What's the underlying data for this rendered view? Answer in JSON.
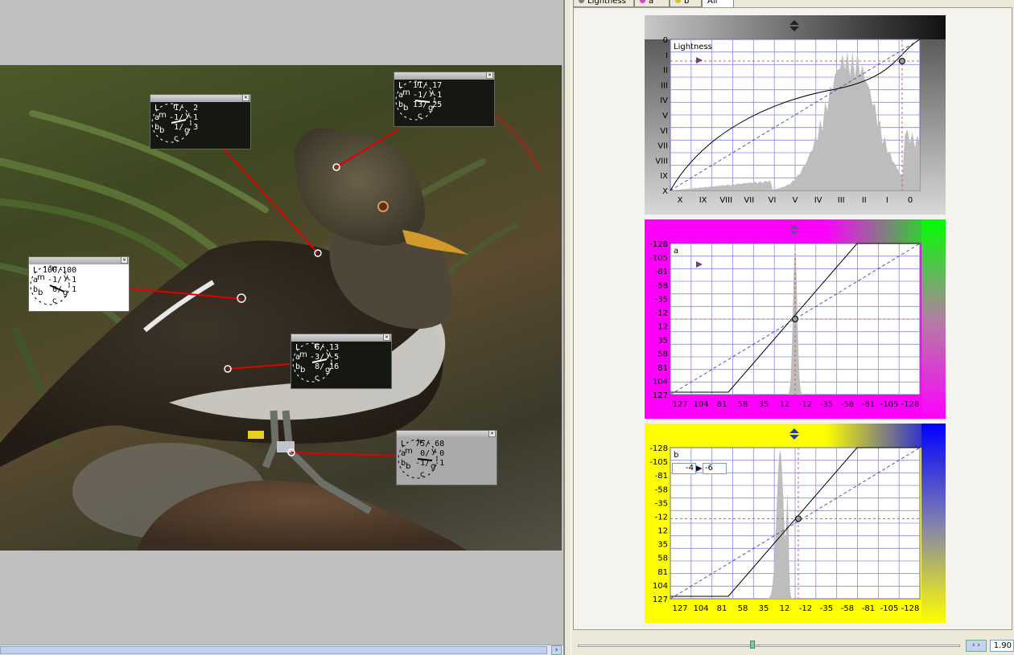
{
  "tabs": [
    {
      "label": "Lightness",
      "dot": "#808080"
    },
    {
      "label": "a",
      "dot": "#e03ce0"
    },
    {
      "label": "b",
      "dot": "#d8c030"
    },
    {
      "label": "All",
      "dot": ""
    }
  ],
  "samplers": [
    {
      "style": "dark",
      "rows": [
        "L   1/  2",
        "a  -1/ -1",
        "b   1/  3"
      ]
    },
    {
      "style": "dark",
      "rows": [
        "L  11/ 17",
        "a  -1/ -1",
        "b  13/ 25"
      ]
    },
    {
      "style": "white",
      "rows": [
        "L 100/100",
        "a  -1/ -1",
        "b   0/  1"
      ]
    },
    {
      "style": "dark",
      "rows": [
        "L   6/ 13",
        "a  -3/ -5",
        "b   8/ 16"
      ]
    },
    {
      "style": "gray",
      "rows": [
        "L  75/ 68",
        "a   0/  0",
        "b  -1/ -1"
      ]
    }
  ],
  "dial_letters": {
    "m": "m",
    "r": "r",
    "y": "y",
    "g": "g",
    "c": "c",
    "b": "b"
  },
  "lightness": {
    "label": "Lightness",
    "y_ticks": [
      "0",
      "I",
      "II",
      "III",
      "IV",
      "V",
      "VI",
      "VII",
      "VIII",
      "IX",
      "X"
    ],
    "x_ticks": [
      "X",
      "IX",
      "VIII",
      "VII",
      "VI",
      "V",
      "IV",
      "III",
      "II",
      "I",
      "0"
    ]
  },
  "a_channel": {
    "label": "a",
    "y_ticks": [
      "-128",
      "-105",
      "-81",
      "-58",
      "-35",
      "-12",
      "12",
      "35",
      "58",
      "81",
      "104",
      "127"
    ],
    "x_ticks": [
      "127",
      "104",
      "81",
      "58",
      "35",
      "12",
      "-12",
      "-35",
      "-58",
      "-81",
      "-105",
      "-128"
    ]
  },
  "b_channel": {
    "label": "b",
    "y_ticks": [
      "-128",
      "-105",
      "-81",
      "-58",
      "-35",
      "-12",
      "12",
      "35",
      "58",
      "81",
      "104",
      "127"
    ],
    "x_ticks": [
      "127",
      "104",
      "81",
      "58",
      "35",
      "12",
      "-12",
      "-35",
      "-58",
      "-81",
      "-105",
      "-128"
    ],
    "input_value": "-4",
    "output_value": "-6"
  },
  "zoom": {
    "value": "1.90"
  },
  "colors": {
    "panel_l_top": "#808080",
    "panel_a_left": "#ff00ff",
    "panel_a_right": "#00ff00",
    "panel_b_left": "#ffff00",
    "panel_b_right": "#0000ff",
    "leader": "#e00000"
  }
}
